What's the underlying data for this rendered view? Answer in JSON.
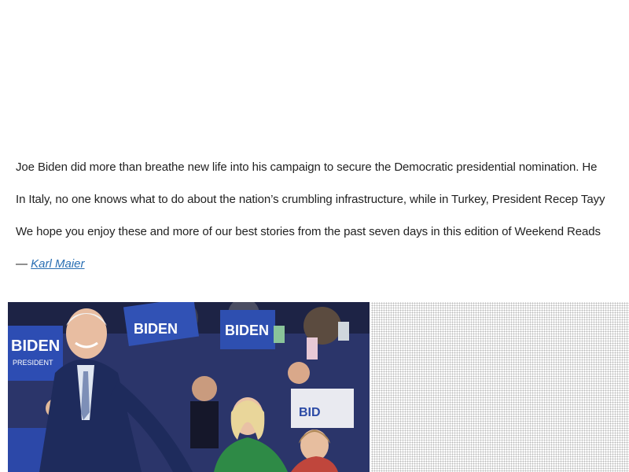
{
  "article": {
    "paragraphs": [
      "Joe Biden did more than breathe new life into his campaign to secure the Democratic presidential nomination. He",
      "In Italy, no one knows what to do about the nation’s crumbling infrastructure, while in Turkey, President Recep Tayy",
      "We hope you enjoy these and more of our best stories from the past seven days in this edition of Weekend Reads"
    ],
    "byline_prefix": "—",
    "author": "Karl Maier",
    "link_color": "#2a6fb3"
  },
  "hero_image": {
    "sign_texts": [
      "BIDEN",
      "PRESIDENT",
      "BIDEN",
      "BIDEN",
      "BID"
    ]
  }
}
